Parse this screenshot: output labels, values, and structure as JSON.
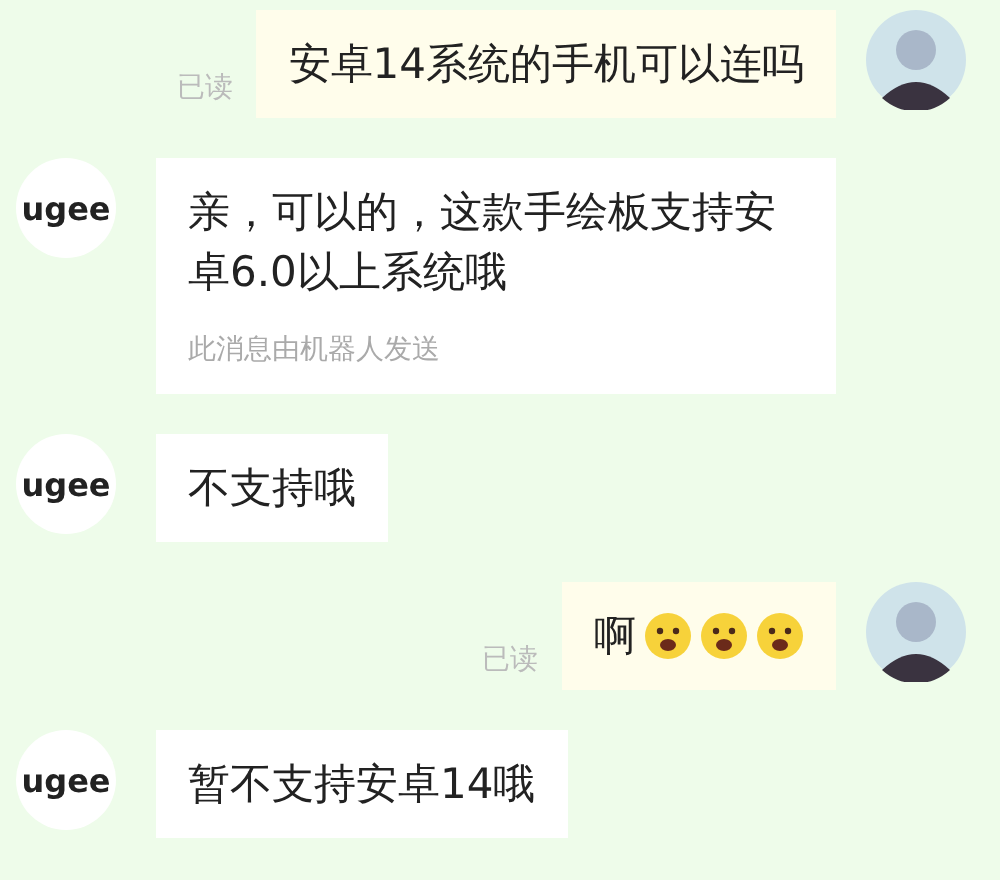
{
  "messages": [
    {
      "kind": "outgoing",
      "text": "安卓14系统的手机可以连吗",
      "read_receipt": "已读"
    },
    {
      "kind": "incoming",
      "avatar_text": "ugee",
      "text": "亲，可以的，这款手绘板支持安卓6.0以上系统哦",
      "footnote": "此消息由机器人发送"
    },
    {
      "kind": "incoming",
      "avatar_text": "ugee",
      "text": "不支持哦"
    },
    {
      "kind": "outgoing",
      "text": "啊",
      "read_receipt": "已读",
      "trailing_icons": [
        {
          "kind": "emoji"
        },
        {
          "kind": "emoji"
        },
        {
          "kind": "emoji"
        }
      ]
    },
    {
      "kind": "incoming",
      "avatar_text": "ugee",
      "text": "暂不支持安卓14哦"
    }
  ]
}
